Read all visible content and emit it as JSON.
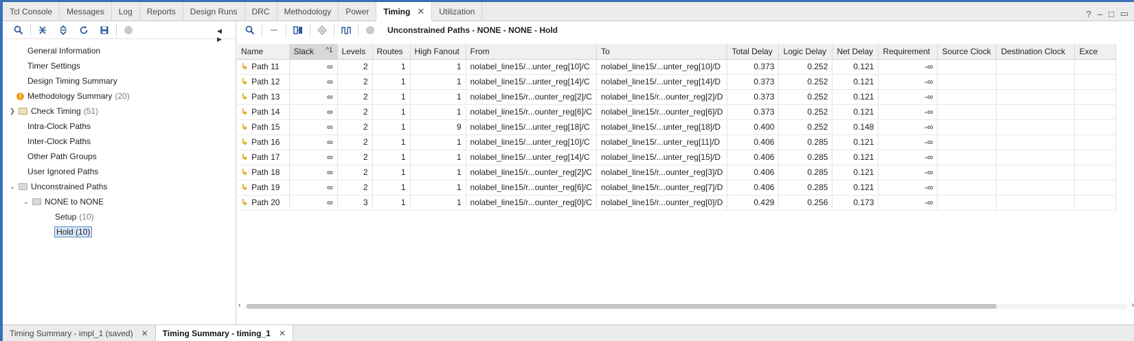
{
  "tabs": [
    {
      "label": "Tcl Console"
    },
    {
      "label": "Messages"
    },
    {
      "label": "Log"
    },
    {
      "label": "Reports"
    },
    {
      "label": "Design Runs"
    },
    {
      "label": "DRC"
    },
    {
      "label": "Methodology"
    },
    {
      "label": "Power"
    },
    {
      "label": "Timing",
      "active": true
    },
    {
      "label": "Utilization"
    }
  ],
  "window_controls": [
    "?",
    "–",
    "□",
    "▭"
  ],
  "tree": {
    "general_information": "General Information",
    "timer_settings": "Timer Settings",
    "design_timing_summary": "Design Timing Summary",
    "methodology_summary": "Methodology Summary",
    "methodology_count": "(20)",
    "check_timing": "Check Timing",
    "check_timing_count": "(51)",
    "intra_clock": "Intra-Clock Paths",
    "inter_clock": "Inter-Clock Paths",
    "other_path_groups": "Other Path Groups",
    "user_ignored": "User Ignored Paths",
    "unconstrained": "Unconstrained Paths",
    "none_to_none": "NONE to NONE",
    "setup": "Setup",
    "setup_count": "(10)",
    "hold": "Hold (10)"
  },
  "right_title": "Unconstrained Paths - NONE - NONE - Hold",
  "columns": [
    "Name",
    "Slack",
    "Levels",
    "Routes",
    "High Fanout",
    "From",
    "To",
    "Total Delay",
    "Logic Delay",
    "Net Delay",
    "Requirement",
    "Source Clock",
    "Destination Clock",
    "Exce"
  ],
  "sort_indicator": "^1",
  "rows": [
    {
      "name": "Path 11",
      "slack": "∞",
      "levels": "2",
      "routes": "1",
      "fanout": "1",
      "from": "nolabel_line15/...unter_reg[10]/C",
      "to": "nolabel_line15/...unter_reg[10]/D",
      "total": "0.373",
      "logic": "0.252",
      "net": "0.121",
      "req": "-∞"
    },
    {
      "name": "Path 12",
      "slack": "∞",
      "levels": "2",
      "routes": "1",
      "fanout": "1",
      "from": "nolabel_line15/...unter_reg[14]/C",
      "to": "nolabel_line15/...unter_reg[14]/D",
      "total": "0.373",
      "logic": "0.252",
      "net": "0.121",
      "req": "-∞"
    },
    {
      "name": "Path 13",
      "slack": "∞",
      "levels": "2",
      "routes": "1",
      "fanout": "1",
      "from": "nolabel_line15/r...ounter_reg[2]/C",
      "to": "nolabel_line15/r...ounter_reg[2]/D",
      "total": "0.373",
      "logic": "0.252",
      "net": "0.121",
      "req": "-∞"
    },
    {
      "name": "Path 14",
      "slack": "∞",
      "levels": "2",
      "routes": "1",
      "fanout": "1",
      "from": "nolabel_line15/r...ounter_reg[6]/C",
      "to": "nolabel_line15/r...ounter_reg[6]/D",
      "total": "0.373",
      "logic": "0.252",
      "net": "0.121",
      "req": "-∞"
    },
    {
      "name": "Path 15",
      "slack": "∞",
      "levels": "2",
      "routes": "1",
      "fanout": "9",
      "from": "nolabel_line15/...unter_reg[18]/C",
      "to": "nolabel_line15/...unter_reg[18]/D",
      "total": "0.400",
      "logic": "0.252",
      "net": "0.148",
      "req": "-∞"
    },
    {
      "name": "Path 16",
      "slack": "∞",
      "levels": "2",
      "routes": "1",
      "fanout": "1",
      "from": "nolabel_line15/...unter_reg[10]/C",
      "to": "nolabel_line15/...unter_reg[11]/D",
      "total": "0.406",
      "logic": "0.285",
      "net": "0.121",
      "req": "-∞"
    },
    {
      "name": "Path 17",
      "slack": "∞",
      "levels": "2",
      "routes": "1",
      "fanout": "1",
      "from": "nolabel_line15/...unter_reg[14]/C",
      "to": "nolabel_line15/...unter_reg[15]/D",
      "total": "0.406",
      "logic": "0.285",
      "net": "0.121",
      "req": "-∞"
    },
    {
      "name": "Path 18",
      "slack": "∞",
      "levels": "2",
      "routes": "1",
      "fanout": "1",
      "from": "nolabel_line15/r...ounter_reg[2]/C",
      "to": "nolabel_line15/r...ounter_reg[3]/D",
      "total": "0.406",
      "logic": "0.285",
      "net": "0.121",
      "req": "-∞"
    },
    {
      "name": "Path 19",
      "slack": "∞",
      "levels": "2",
      "routes": "1",
      "fanout": "1",
      "from": "nolabel_line15/r...ounter_reg[6]/C",
      "to": "nolabel_line15/r...ounter_reg[7]/D",
      "total": "0.406",
      "logic": "0.285",
      "net": "0.121",
      "req": "-∞"
    },
    {
      "name": "Path 20",
      "slack": "∞",
      "levels": "3",
      "routes": "1",
      "fanout": "1",
      "from": "nolabel_line15/r...ounter_reg[0]/C",
      "to": "nolabel_line15/r...ounter_reg[0]/D",
      "total": "0.429",
      "logic": "0.256",
      "net": "0.173",
      "req": "-∞"
    }
  ],
  "bottom_tabs": [
    {
      "label": "Timing Summary - impl_1 (saved)"
    },
    {
      "label": "Timing Summary - timing_1",
      "active": true
    }
  ],
  "colors": {
    "accent": "#3b6fb6",
    "path_icon": "#e0a000",
    "warning": "#f0a01e",
    "selection": "#d6e6f8"
  }
}
